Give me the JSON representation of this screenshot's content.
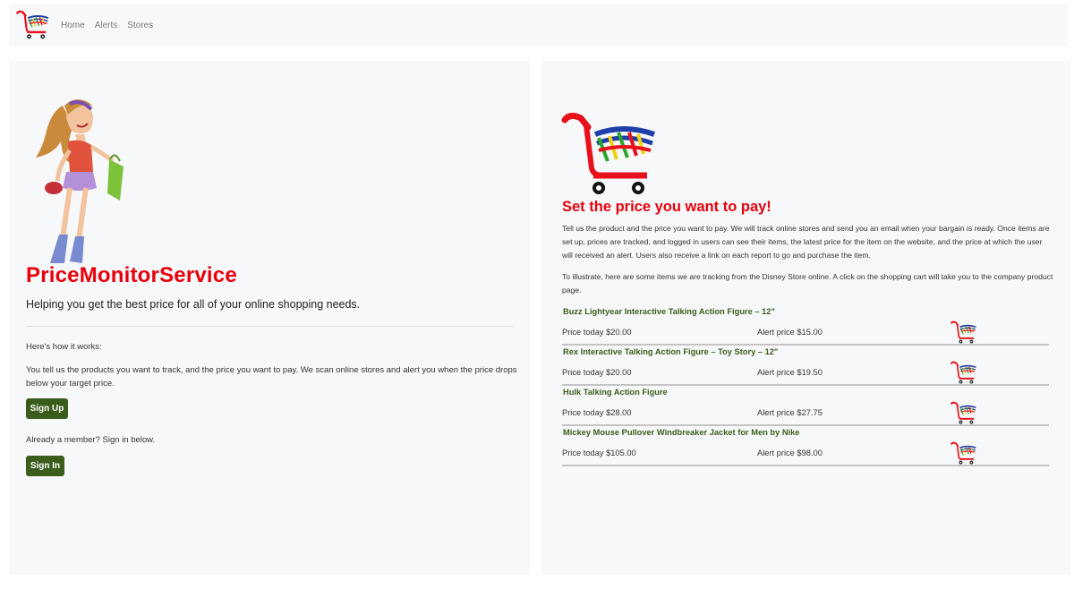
{
  "nav": {
    "links": [
      "Home",
      "Alerts",
      "Stores"
    ]
  },
  "left": {
    "brand": "PriceMonitorService",
    "lead": "Helping you get the best price for all of your online shopping needs.",
    "how_label": "Here's how it works:",
    "description": "You tell us the products you want to track, and the price you want to pay. We scan online stores and alert you when the price drops below your target price.",
    "signup_label": "Sign Up",
    "member_text": "Already a member? Sign in below.",
    "signin_label": "Sign In"
  },
  "right": {
    "title": "Set the price you want to pay!",
    "intro": "Tell us the product and the price you want to pay. We will track online stores and send you an email when your bargain is ready. Once items are set up, prices are tracked, and logged in users can see their items, the latest price for the item on the website, and the price at which the user will received an alert. Users also receive a link on each report to go and purchase the item.",
    "illustrate": "To illustrate, here are some items we are tracking from the Disney Store online. A click on the shopping cart will take you to the company product page.",
    "items": [
      {
        "name": "Buzz Lightyear Interactive Talking Action Figure – 12\"",
        "today": "Price today $20.00",
        "alert": "Alert price $15.00"
      },
      {
        "name": "Rex Interactive Talking Action Figure – Toy Story – 12\"",
        "today": "Price today $20.00",
        "alert": "Alert price $19.50"
      },
      {
        "name": "Hulk Talking Action Figure",
        "today": "Price today $28.00",
        "alert": "Alert price $27.75"
      },
      {
        "name": "Mickey Mouse Pullover Windbreaker Jacket for Men by Nike",
        "today": "Price today $105.00",
        "alert": "Alert price $98.00"
      }
    ]
  },
  "colors": {
    "brand_red": "#e8000b",
    "button_green": "#3b5d1b",
    "panel_bg": "#f7f8fa"
  }
}
